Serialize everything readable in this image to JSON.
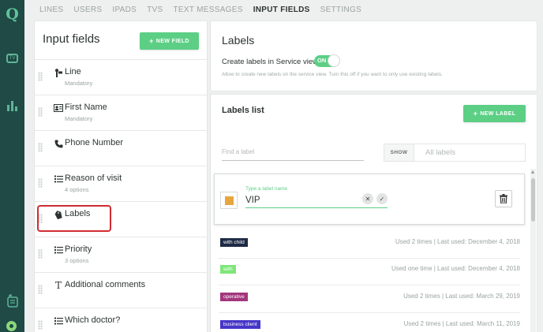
{
  "app": {
    "logo_letter": "Q",
    "tv_icon_text": "TV"
  },
  "tabs": [
    {
      "label": "LINES",
      "active": false
    },
    {
      "label": "USERS",
      "active": false
    },
    {
      "label": "IPADS",
      "active": false
    },
    {
      "label": "TVS",
      "active": false
    },
    {
      "label": "TEXT MESSAGES",
      "active": false
    },
    {
      "label": "INPUT FIELDS",
      "active": true
    },
    {
      "label": "SETTINGS",
      "active": false
    }
  ],
  "input_fields": {
    "title": "Input fields",
    "new_button": "NEW FIELD",
    "items": [
      {
        "name": "Line",
        "sub": "Mandatory",
        "icon": "line-icon"
      },
      {
        "name": "First Name",
        "sub": "Mandatory",
        "icon": "id-card-icon"
      },
      {
        "name": "Phone Number",
        "sub": "",
        "icon": "phone-icon"
      },
      {
        "name": "Reason of visit",
        "sub": "4 options",
        "icon": "list-icon"
      },
      {
        "name": "Labels",
        "sub": "",
        "icon": "tag-icon",
        "highlighted": true
      },
      {
        "name": "Priority",
        "sub": "3 options",
        "icon": "list-icon"
      },
      {
        "name": "Additional comments",
        "sub": "",
        "icon": "text-icon"
      },
      {
        "name": "Which doctor?",
        "sub": "",
        "icon": "list-icon"
      }
    ]
  },
  "labels_settings": {
    "title": "Labels",
    "create_text": "Create labels in Service view",
    "toggle_label": "ON",
    "toggle_on": true,
    "help": "Allow to create new labels on the service view. Turn this off if you want to only use existing labels."
  },
  "labels_list": {
    "title": "Labels list",
    "new_button": "NEW LABEL",
    "search_placeholder": "Find a label",
    "show_button": "SHOW",
    "show_value": "All labels",
    "editor": {
      "field_label": "Type a label name",
      "value": "VIP",
      "color": "#e7a53d"
    },
    "labels": [
      {
        "name": "with child",
        "color": "#1d2a44",
        "stats": "Used 2 times | Last used: December 4, 2018"
      },
      {
        "name": "with",
        "color": "#7ee67a",
        "stats": "Used one time | Last used: December 4, 2018"
      },
      {
        "name": "operative",
        "color": "#a2367d",
        "stats": "Used 2 times | Last used: March 29, 2019"
      },
      {
        "name": "business client",
        "color": "#4636c7",
        "stats": "Used 2 times | Last used: March 11, 2019"
      }
    ]
  },
  "colors": {
    "accent": "#5ccf85",
    "rail": "#1f4a46",
    "highlight": "#cf2c32"
  }
}
